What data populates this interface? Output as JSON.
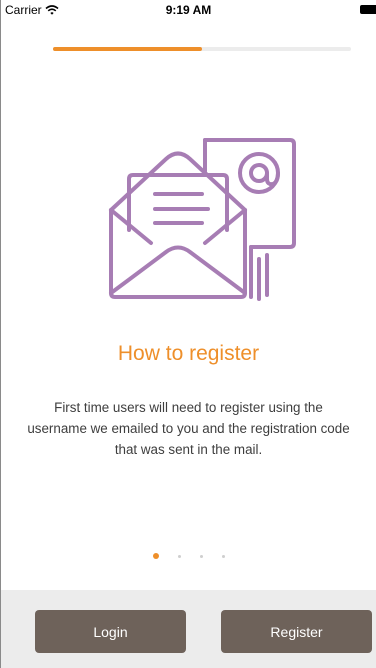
{
  "status_bar": {
    "carrier": "Carrier",
    "time": "9:19 AM"
  },
  "progress": {
    "fraction": 0.5,
    "color": "#ee8f2a"
  },
  "illustration": {
    "icon": "envelope-at-icon",
    "color": "#a77db4"
  },
  "content": {
    "title": "How to register",
    "description": "First time users will need to register using the username we emailed to you and the registration code that was sent in the mail."
  },
  "pager": {
    "count": 4,
    "active_index": 0
  },
  "footer": {
    "login_label": "Login",
    "register_label": "Register"
  },
  "colors": {
    "accent": "#ee8f2a",
    "button": "#6e625a",
    "footer_bg": "#ececec"
  }
}
